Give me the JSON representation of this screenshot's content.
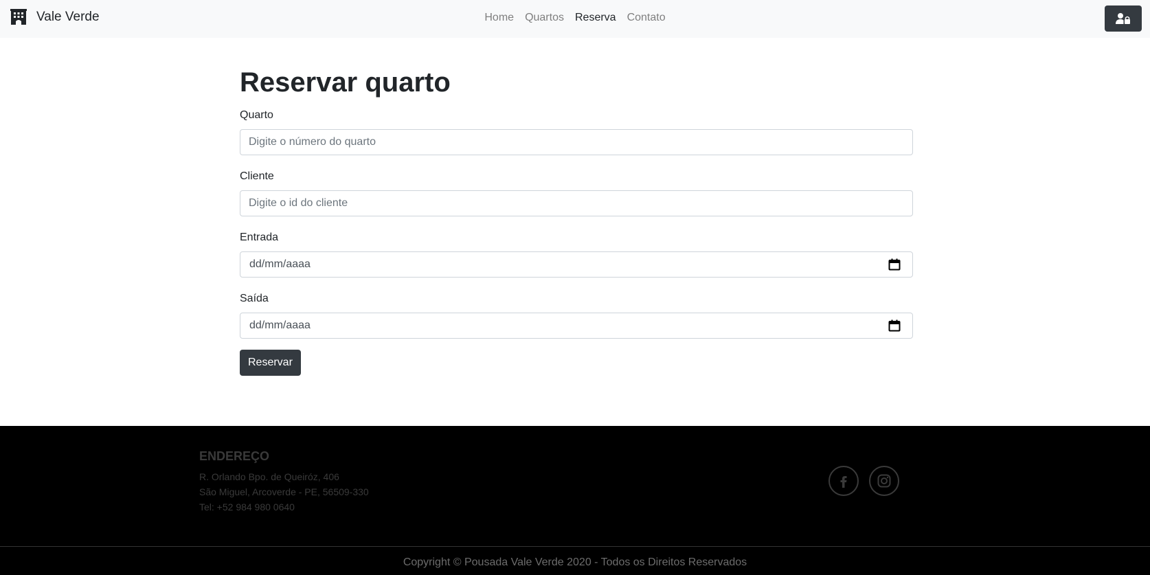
{
  "navbar": {
    "brand": "Vale Verde",
    "links": [
      {
        "label": "Home",
        "active": false
      },
      {
        "label": "Quartos",
        "active": false
      },
      {
        "label": "Reserva",
        "active": true
      },
      {
        "label": "Contato",
        "active": false
      }
    ],
    "login_icon": "user-lock-icon"
  },
  "form": {
    "title": "Reservar quarto",
    "room_label": "Quarto",
    "room_placeholder": "Digite o número do quarto",
    "client_label": "Cliente",
    "client_placeholder": "Digite o id do cliente",
    "checkin_label": "Entrada",
    "checkin_value": "dd/mm/aaaa",
    "checkout_label": "Saída",
    "checkout_value": "dd/mm/aaaa",
    "submit_label": "Reservar"
  },
  "footer": {
    "address_title": "ENDEREÇO",
    "address_line1": "R. Orlando Bpo. de Queiróz, 406",
    "address_line2": "São Miguel, Arcoverde - PE, 56509-330",
    "phone": "Tel: +52 984 980 0640",
    "social": [
      "facebook-icon",
      "instagram-icon"
    ],
    "copyright": "Copyright © Pousada Vale Verde 2020 - Todos os Direitos Reservados"
  },
  "colors": {
    "navbar_bg": "#f8f9fa",
    "dark_button": "#343a40",
    "footer_bg": "#000000"
  }
}
